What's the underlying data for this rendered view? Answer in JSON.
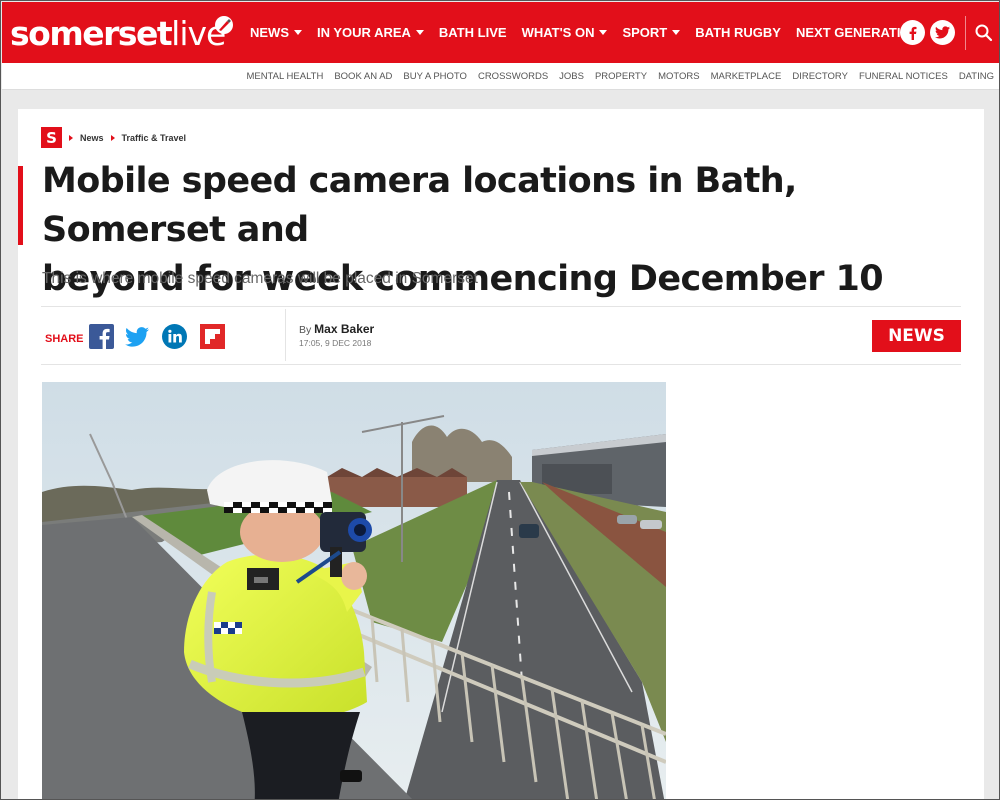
{
  "brand": {
    "logo_bold": "somerset",
    "logo_light": "live",
    "primary_color": "#e20f1a"
  },
  "nav": {
    "items": [
      {
        "label": "NEWS",
        "dropdown": true
      },
      {
        "label": "IN YOUR AREA",
        "dropdown": true
      },
      {
        "label": "BATH LIVE",
        "dropdown": false
      },
      {
        "label": "WHAT'S ON",
        "dropdown": true
      },
      {
        "label": "SPORT",
        "dropdown": true
      },
      {
        "label": "BATH RUGBY",
        "dropdown": false
      },
      {
        "label": "NEXT GENERATION",
        "dropdown": false
      }
    ],
    "icons": [
      "facebook-icon",
      "twitter-icon",
      "search-icon"
    ]
  },
  "subnav": {
    "items": [
      "MENTAL HEALTH",
      "BOOK AN AD",
      "BUY A PHOTO",
      "CROSSWORDS",
      "JOBS",
      "PROPERTY",
      "MOTORS",
      "MARKETPLACE",
      "DIRECTORY",
      "FUNERAL NOTICES",
      "DATING"
    ]
  },
  "article": {
    "logo_letter": "S",
    "breadcrumb": [
      "News",
      "Traffic & Travel"
    ],
    "headline_line1": "Mobile speed camera locations in Bath, Somerset and",
    "headline_line2": "beyond for week commencing December 10",
    "standfirst": "This is where mobile speed cameras will be placed in Somerset",
    "share_label": "SHARE",
    "share_icons": [
      "facebook-icon",
      "twitter-icon",
      "linkedin-icon",
      "flipboard-icon"
    ],
    "byline_prefix": "By ",
    "author": "Max Baker",
    "timestamp": "17:05, 9 DEC 2018",
    "category_badge": "NEWS"
  }
}
